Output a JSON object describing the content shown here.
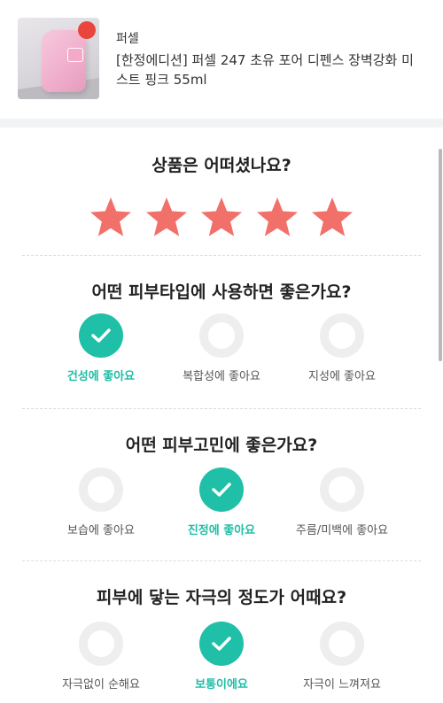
{
  "product": {
    "brand": "퍼셀",
    "name": "[한정에디션] 퍼셀 247 초유 포어 디펜스 장벽강화 미스트 핑크 55ml",
    "image_badge_icon": "limited-badge-icon"
  },
  "rating": {
    "question": "상품은 어떠셨나요?",
    "stars": 5,
    "max_stars": 5,
    "star_color": "#f2706a"
  },
  "skin_type": {
    "question": "어떤 피부타입에 사용하면 좋은가요?",
    "options": [
      {
        "label": "건성에 좋아요",
        "selected": true
      },
      {
        "label": "복합성에 좋아요",
        "selected": false
      },
      {
        "label": "지성에 좋아요",
        "selected": false
      }
    ]
  },
  "skin_concern": {
    "question": "어떤 피부고민에 좋은가요?",
    "options": [
      {
        "label": "보습에 좋아요",
        "selected": false
      },
      {
        "label": "진정에 좋아요",
        "selected": true
      },
      {
        "label": "주름/미백에 좋아요",
        "selected": false
      }
    ]
  },
  "irritation": {
    "question": "피부에 닿는 자극의 정도가 어때요?",
    "options": [
      {
        "label": "자극없이 순해요",
        "selected": false
      },
      {
        "label": "보통이에요",
        "selected": true
      },
      {
        "label": "자극이 느껴져요",
        "selected": false
      }
    ]
  },
  "colors": {
    "accent": "#1fc0a7",
    "unselected_ring": "#eeeeee",
    "star": "#f2706a"
  }
}
